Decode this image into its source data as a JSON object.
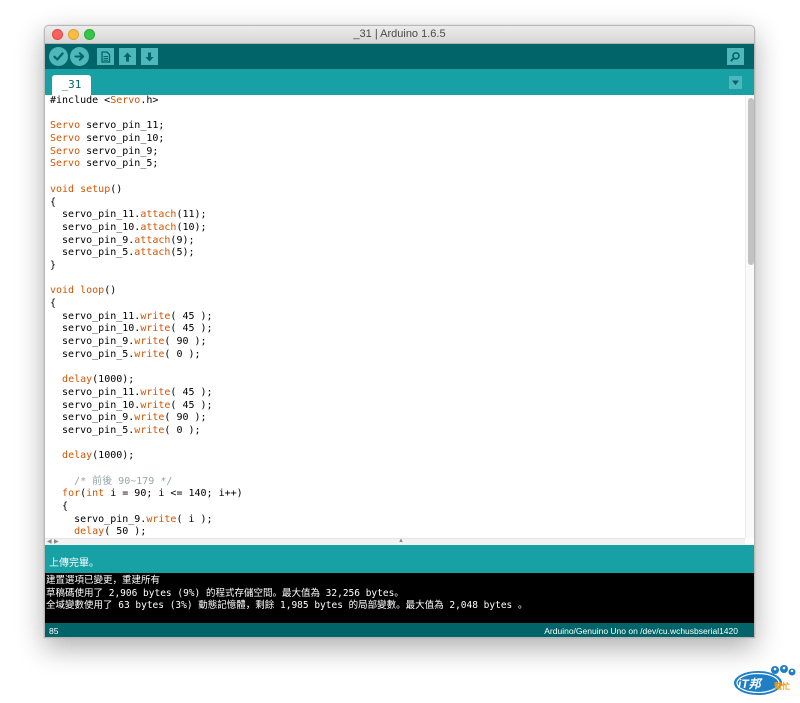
{
  "window": {
    "title": "_31 | Arduino 1.6.5"
  },
  "toolbar": {
    "verify_icon": "checkmark-icon",
    "upload_icon": "arrow-right-icon",
    "new_icon": "document-icon",
    "open_icon": "arrow-up-icon",
    "save_icon": "arrow-down-icon",
    "serial_monitor_icon": "magnifier-icon"
  },
  "tabs": [
    {
      "label": "_31"
    }
  ],
  "editor": {
    "lines": [
      "#include <Servo.h>",
      "",
      "Servo servo_pin_11;",
      "Servo servo_pin_10;",
      "Servo servo_pin_9;",
      "Servo servo_pin_5;",
      "",
      "void setup()",
      "{",
      "  servo_pin_11.attach(11);",
      "  servo_pin_10.attach(10);",
      "  servo_pin_9.attach(9);",
      "  servo_pin_5.attach(5);",
      "}",
      "",
      "void loop()",
      "{",
      "  servo_pin_11.write( 45 );",
      "  servo_pin_10.write( 45 );",
      "  servo_pin_9.write( 90 );",
      "  servo_pin_5.write( 0 );",
      "",
      "  delay(1000);",
      "  servo_pin_11.write( 45 );",
      "  servo_pin_10.write( 45 );",
      "  servo_pin_9.write( 90 );",
      "  servo_pin_5.write( 0 );",
      "",
      "  delay(1000);",
      "",
      "    /* 前後 90~179 */",
      "  for(int i = 90; i <= 140; i++)",
      "  {",
      "    servo_pin_9.write( i );",
      "    delay( 50 );"
    ]
  },
  "status": {
    "message": "上傳完畢。"
  },
  "console": {
    "lines": [
      "建置選項已變更，重建所有",
      "草稿碼使用了 2,906 bytes (9%) 的程式存儲空間。最大值為 32,256 bytes。",
      "全域變數使用了 63 bytes (3%) 動態記憶體，剩餘 1,985 bytes 的局部變數。最大值為 2,048 bytes 。"
    ]
  },
  "footer": {
    "line_number": "85",
    "board": "Arduino/Genuino Uno on /dev/cu.wchusbserial1420"
  },
  "watermark": {
    "text": "iT邦幫忙"
  },
  "colors": {
    "toolbar": "#006468",
    "tabbar": "#17a1a5",
    "button": "#4db7bb",
    "keyword": "#d35400",
    "comment": "#95a5a6"
  }
}
